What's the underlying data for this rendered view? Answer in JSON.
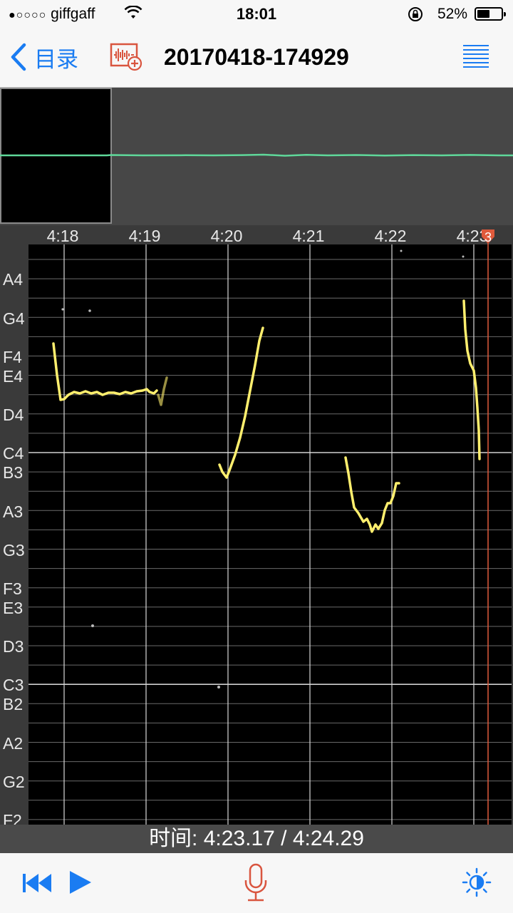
{
  "status": {
    "carrier": "giffgaff",
    "signal_dots": "●○○○○",
    "time": "18:01",
    "battery_percent": "52%",
    "battery_level": 0.52
  },
  "nav": {
    "back_label": "目录",
    "title": "20170418-174929"
  },
  "timeline": {
    "time_labels": [
      "4:18",
      "4:19",
      "4:20",
      "4:21",
      "4:22",
      "4:23"
    ],
    "playhead_marker": "3"
  },
  "notes": [
    "A4",
    "G4",
    "F4",
    "E4",
    "D4",
    "C4",
    "B3",
    "A3",
    "G3",
    "F3",
    "E3",
    "D3",
    "C3",
    "B2",
    "A2",
    "G2",
    "F2"
  ],
  "playback": {
    "time_prefix": "时间:",
    "current": "4:23.17",
    "total": "4:24.29",
    "display": "时间: 4:23.17 / 4:24.29"
  },
  "colors": {
    "accent": "#1a7cf2",
    "pitch": "#ffef6e",
    "waveform": "#5fd89a",
    "playhead": "#e05a3c",
    "mic": "#d9553f"
  },
  "icons": {
    "back": "chevron-left-icon",
    "add_recording": "add-recording-icon",
    "menu": "list-menu-icon",
    "rewind": "rewind-icon",
    "play": "play-icon",
    "mic": "microphone-icon",
    "brightness": "brightness-icon"
  }
}
